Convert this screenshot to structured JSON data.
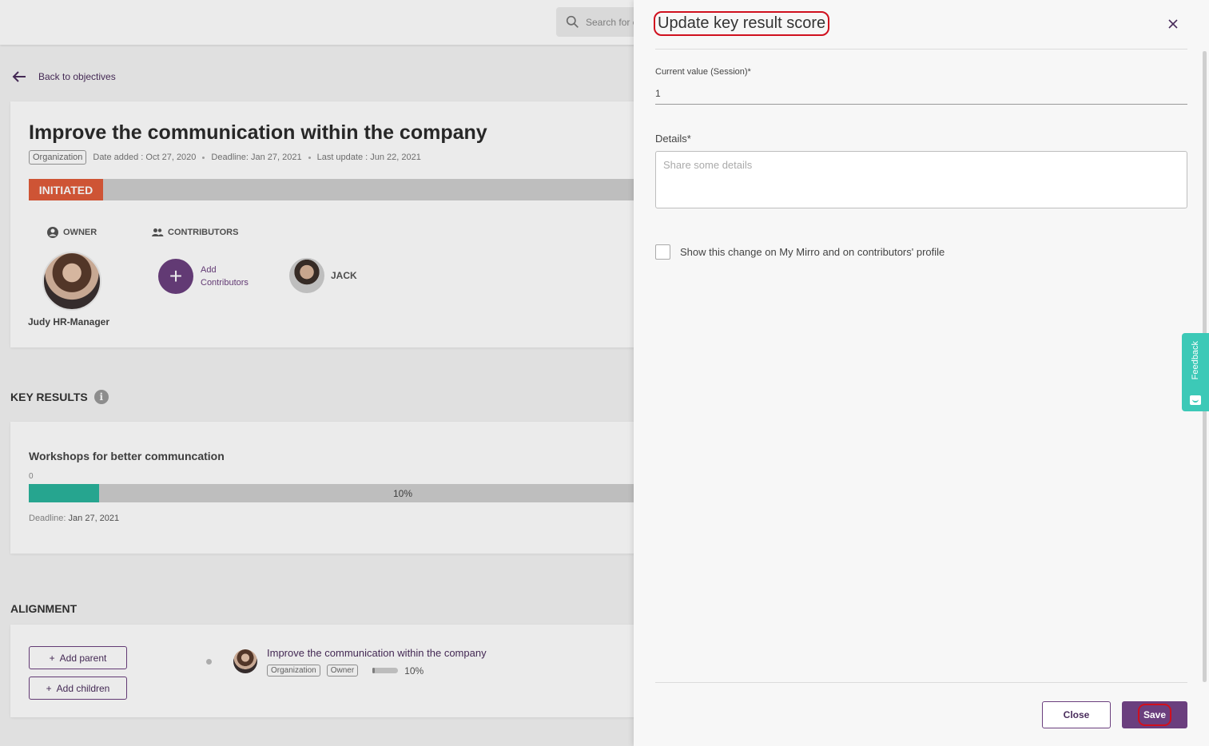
{
  "background": {
    "search_placeholder": "Search for c",
    "back_link": "Back to objectives",
    "objective": {
      "title": "Improve the communication within the company",
      "tag": "Organization",
      "date_added": "Date added : Oct 27, 2020",
      "deadline": "Deadline: Jan 27, 2021",
      "last_update": "Last update : Jun 22, 2021",
      "status": "INITIATED",
      "owner_label": "OWNER",
      "owner_name": "Judy HR-Manager",
      "contributors_label": "CONTRIBUTORS",
      "add_contributors": "Add Contributors",
      "contributor_name": "JACK"
    },
    "key_results": {
      "section_title": "KEY RESULTS",
      "item_title": "Workshops for better communcation",
      "start_value": "0",
      "progress_label": "10%",
      "progress_fraction": 0.1,
      "deadline_label": "Deadline:",
      "deadline_value": "Jan 27, 2021"
    },
    "alignment": {
      "section_title": "ALIGNMENT",
      "add_parent": "Add parent",
      "add_children": "Add children",
      "item_title": "Improve the communication within the company",
      "tag_org": "Organization",
      "tag_owner": "Owner",
      "progress_label": "10%",
      "progress_fraction": 0.1
    }
  },
  "drawer": {
    "title": "Update key result score",
    "current_value_label": "Current value (Session)*",
    "current_value": "1",
    "details_label": "Details*",
    "details_placeholder": "Share some details",
    "checkbox_label": "Show this change on My Mirro and on contributors' profile",
    "close_button": "Close",
    "save_button": "Save"
  },
  "feedback_tab": {
    "label": "Feedback"
  },
  "colors": {
    "primary": "#6b3f7e",
    "status_initiated": "#e05c3a",
    "progress_teal": "#2ab39c",
    "feedback": "#3cc9b7",
    "highlight_red": "#d0101e"
  }
}
